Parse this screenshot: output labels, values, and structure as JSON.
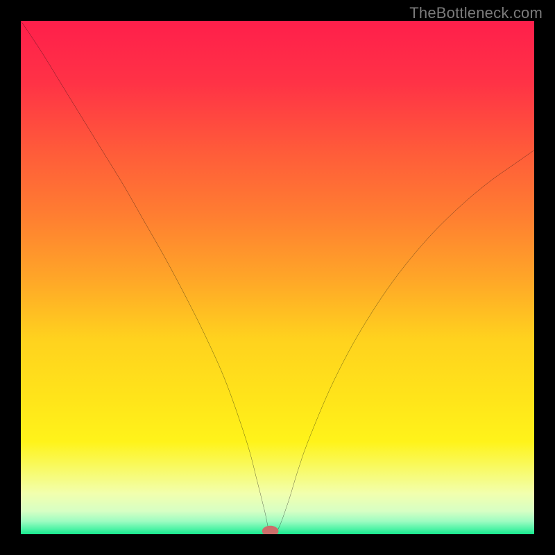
{
  "watermark": "TheBottleneck.com",
  "chart_data": {
    "type": "line",
    "title": "",
    "xlabel": "",
    "ylabel": "",
    "xlim": [
      0,
      100
    ],
    "ylim": [
      0,
      100
    ],
    "grid": false,
    "legend": false,
    "background": {
      "type": "vertical-gradient",
      "stops": [
        {
          "pos": 0.0,
          "color": "#ff1f4b"
        },
        {
          "pos": 0.12,
          "color": "#ff3246"
        },
        {
          "pos": 0.25,
          "color": "#ff5a3a"
        },
        {
          "pos": 0.38,
          "color": "#ff7e31"
        },
        {
          "pos": 0.5,
          "color": "#ffa528"
        },
        {
          "pos": 0.62,
          "color": "#ffd21e"
        },
        {
          "pos": 0.74,
          "color": "#ffe51a"
        },
        {
          "pos": 0.82,
          "color": "#fff31a"
        },
        {
          "pos": 0.88,
          "color": "#f7fb71"
        },
        {
          "pos": 0.92,
          "color": "#f2ffad"
        },
        {
          "pos": 0.955,
          "color": "#d7ffc4"
        },
        {
          "pos": 0.975,
          "color": "#9dfcc1"
        },
        {
          "pos": 0.99,
          "color": "#4ef3a6"
        },
        {
          "pos": 1.0,
          "color": "#17e98e"
        }
      ]
    },
    "series": [
      {
        "name": "bottleneck-curve",
        "color": "#111111",
        "width": 2.4,
        "x": [
          0,
          4,
          8,
          12,
          16,
          20,
          24,
          28,
          32,
          36,
          40,
          44,
          46,
          47.5,
          48.5,
          50,
          52,
          54,
          56,
          60,
          64,
          68,
          72,
          76,
          80,
          84,
          88,
          92,
          96,
          100
        ],
        "y": [
          100,
          94,
          87.5,
          81,
          74.5,
          68,
          61,
          54,
          46.5,
          38.5,
          29.5,
          18,
          10.5,
          4.5,
          0.5,
          0.8,
          6,
          12.5,
          18.2,
          27.8,
          35.8,
          42.6,
          48.6,
          53.8,
          58.4,
          62.4,
          66,
          69.2,
          72,
          74.8
        ]
      }
    ],
    "marker": {
      "name": "optimal-point",
      "x": 48.6,
      "y": 0.6,
      "rx": 1.6,
      "ry": 1.05,
      "color": "#cc6e6a"
    }
  }
}
